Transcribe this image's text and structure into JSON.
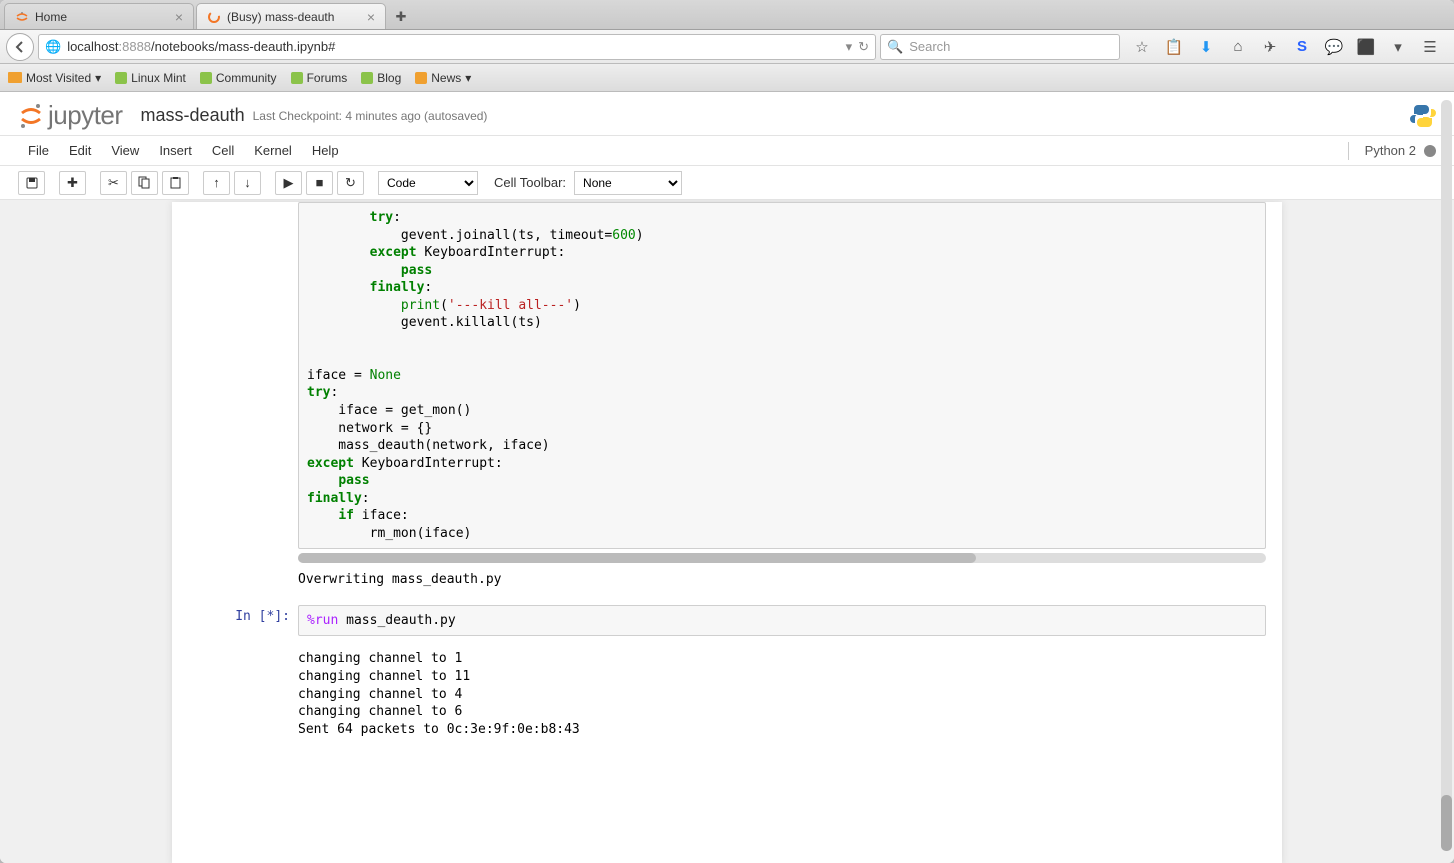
{
  "browser": {
    "tabs": [
      {
        "title": "Home"
      },
      {
        "title": "(Busy) mass-deauth"
      }
    ],
    "url_host": "localhost",
    "url_port": ":8888",
    "url_path": "/notebooks/mass-deauth.ipynb#",
    "search_placeholder": "Search",
    "bookmarks": [
      "Most Visited",
      "Linux Mint",
      "Community",
      "Forums",
      "Blog",
      "News"
    ]
  },
  "jupyter": {
    "brand": "jupyter",
    "title": "mass-deauth",
    "checkpoint": "Last Checkpoint: 4 minutes ago (autosaved)",
    "menus": [
      "File",
      "Edit",
      "View",
      "Insert",
      "Cell",
      "Kernel",
      "Help"
    ],
    "kernel": "Python 2",
    "celltype": "Code",
    "cell_toolbar_label": "Cell Toolbar:",
    "cell_toolbar_value": "None"
  },
  "cells": {
    "output1": "Overwriting mass_deauth.py",
    "prompt2": "In [*]:",
    "input2": "%run mass_deauth.py",
    "output2": "changing channel to 1\nchanging channel to 11\nchanging channel to 4\nchanging channel to 6\nSent 64 packets to 0c:3e:9f:0e:b8:43"
  }
}
